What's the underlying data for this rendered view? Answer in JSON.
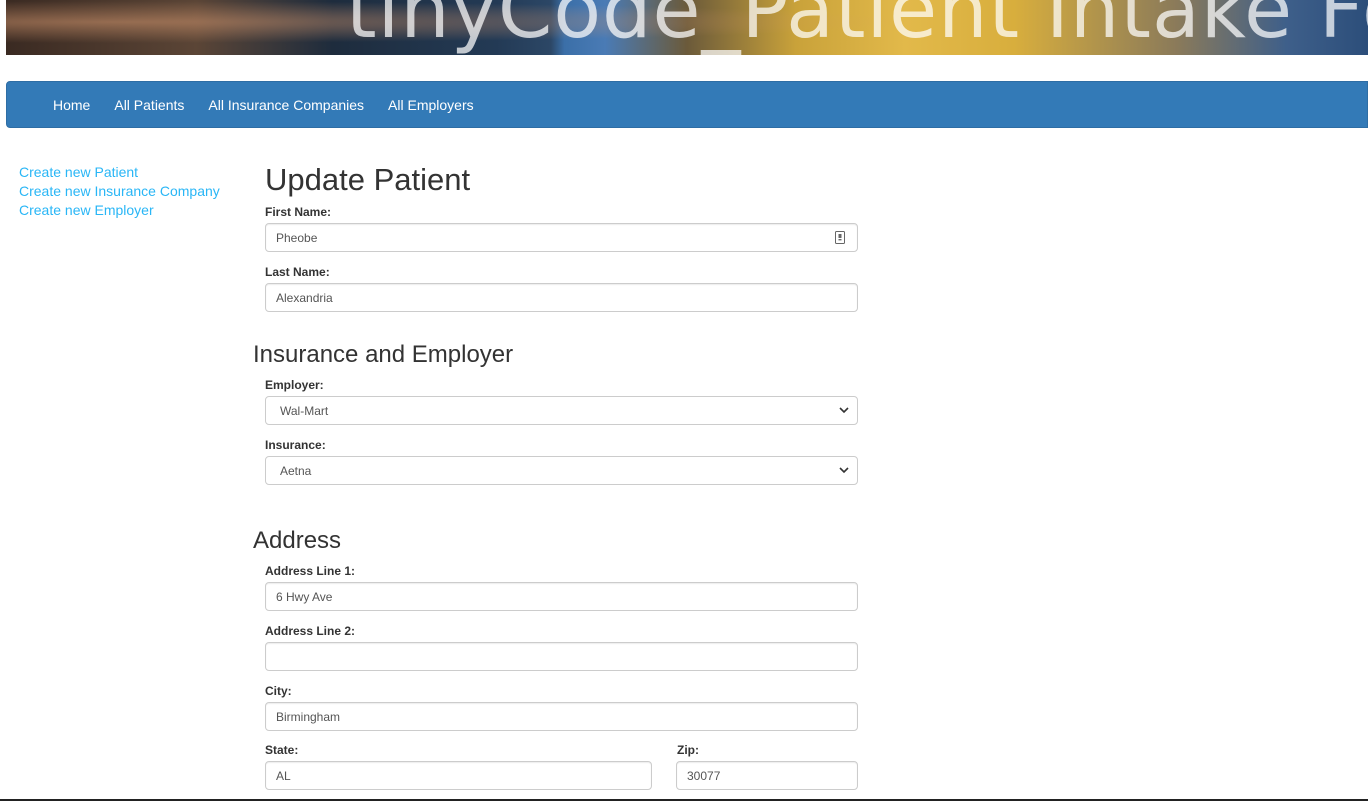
{
  "banner": {
    "title": "tinyCode_Patient Intake Form"
  },
  "nav": {
    "items": [
      {
        "label": "Home"
      },
      {
        "label": "All Patients"
      },
      {
        "label": "All Insurance Companies"
      },
      {
        "label": "All Employers"
      }
    ]
  },
  "sidebar": {
    "links": [
      {
        "label": "Create new Patient"
      },
      {
        "label": "Create new Insurance Company"
      },
      {
        "label": "Create new Employer"
      }
    ]
  },
  "form": {
    "title": "Update Patient",
    "first_name": {
      "label": "First Name:",
      "value": "Pheobe"
    },
    "last_name": {
      "label": "Last Name:",
      "value": "Alexandria"
    },
    "section_insurance": "Insurance and Employer",
    "employer": {
      "label": "Employer:",
      "value": "Wal-Mart"
    },
    "insurance": {
      "label": "Insurance:",
      "value": "Aetna"
    },
    "section_address": "Address",
    "address1": {
      "label": "Address Line 1:",
      "value": "6 Hwy Ave"
    },
    "address2": {
      "label": "Address Line 2:",
      "value": ""
    },
    "city": {
      "label": "City:",
      "value": "Birmingham"
    },
    "state": {
      "label": "State:",
      "value": "AL"
    },
    "zip": {
      "label": "Zip:",
      "value": "30077"
    }
  },
  "colors": {
    "navbar": "#337ab7",
    "link": "#29b6f6",
    "nav_text": "#ffffff"
  },
  "icons": [
    "autofill-icon",
    "chevron-down-icon"
  ]
}
